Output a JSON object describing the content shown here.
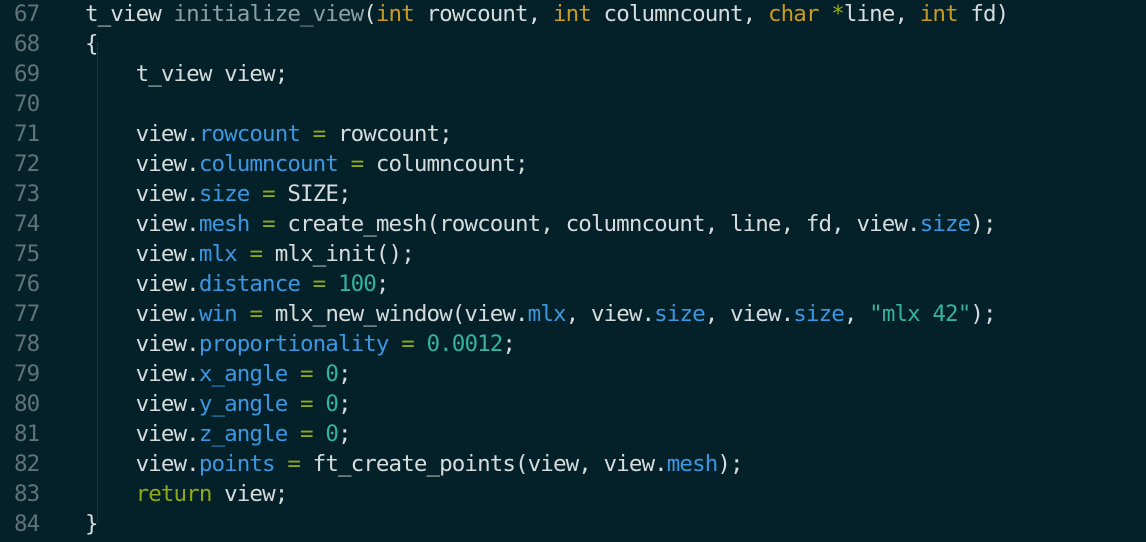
{
  "editor": {
    "colors": {
      "background": "#042029",
      "line_number": "#5f7378",
      "plain": "#d6dcdc",
      "function_name": "#8aa0a4",
      "type": "#c99b22",
      "property": "#3c97e0",
      "operator": "#8fa818",
      "number": "#33b3a0",
      "string": "#33b3a0",
      "keyword": "#8fa818"
    },
    "lines": [
      {
        "num": "67",
        "tokens": [
          {
            "t": "t_view ",
            "c": "plain"
          },
          {
            "t": "initialize_view",
            "c": "func"
          },
          {
            "t": "(",
            "c": "plain"
          },
          {
            "t": "int",
            "c": "type"
          },
          {
            "t": " rowcount, ",
            "c": "plain"
          },
          {
            "t": "int",
            "c": "type"
          },
          {
            "t": " columncount, ",
            "c": "plain"
          },
          {
            "t": "char",
            "c": "type"
          },
          {
            "t": " ",
            "c": "plain"
          },
          {
            "t": "*",
            "c": "op"
          },
          {
            "t": "line, ",
            "c": "plain"
          },
          {
            "t": "int",
            "c": "type"
          },
          {
            "t": " fd)",
            "c": "plain"
          }
        ]
      },
      {
        "num": "68",
        "tokens": [
          {
            "t": "{",
            "c": "plain"
          }
        ]
      },
      {
        "num": "69",
        "tokens": [
          {
            "t": "    t_view view;",
            "c": "plain"
          }
        ]
      },
      {
        "num": "70",
        "tokens": []
      },
      {
        "num": "71",
        "tokens": [
          {
            "t": "    view.",
            "c": "plain"
          },
          {
            "t": "rowcount",
            "c": "prop"
          },
          {
            "t": " ",
            "c": "plain"
          },
          {
            "t": "=",
            "c": "op"
          },
          {
            "t": " rowcount;",
            "c": "plain"
          }
        ]
      },
      {
        "num": "72",
        "tokens": [
          {
            "t": "    view.",
            "c": "plain"
          },
          {
            "t": "columncount",
            "c": "prop"
          },
          {
            "t": " ",
            "c": "plain"
          },
          {
            "t": "=",
            "c": "op"
          },
          {
            "t": " columncount;",
            "c": "plain"
          }
        ]
      },
      {
        "num": "73",
        "tokens": [
          {
            "t": "    view.",
            "c": "plain"
          },
          {
            "t": "size",
            "c": "prop"
          },
          {
            "t": " ",
            "c": "plain"
          },
          {
            "t": "=",
            "c": "op"
          },
          {
            "t": " SIZE;",
            "c": "plain"
          }
        ]
      },
      {
        "num": "74",
        "tokens": [
          {
            "t": "    view.",
            "c": "plain"
          },
          {
            "t": "mesh",
            "c": "prop"
          },
          {
            "t": " ",
            "c": "plain"
          },
          {
            "t": "=",
            "c": "op"
          },
          {
            "t": " create_mesh(rowcount, columncount, line, fd, view.",
            "c": "plain"
          },
          {
            "t": "size",
            "c": "prop"
          },
          {
            "t": ");",
            "c": "plain"
          }
        ]
      },
      {
        "num": "75",
        "tokens": [
          {
            "t": "    view.",
            "c": "plain"
          },
          {
            "t": "mlx",
            "c": "prop"
          },
          {
            "t": " ",
            "c": "plain"
          },
          {
            "t": "=",
            "c": "op"
          },
          {
            "t": " mlx_init();",
            "c": "plain"
          }
        ]
      },
      {
        "num": "76",
        "tokens": [
          {
            "t": "    view.",
            "c": "plain"
          },
          {
            "t": "distance",
            "c": "prop"
          },
          {
            "t": " ",
            "c": "plain"
          },
          {
            "t": "=",
            "c": "op"
          },
          {
            "t": " ",
            "c": "plain"
          },
          {
            "t": "100",
            "c": "num"
          },
          {
            "t": ";",
            "c": "plain"
          }
        ]
      },
      {
        "num": "77",
        "tokens": [
          {
            "t": "    view.",
            "c": "plain"
          },
          {
            "t": "win",
            "c": "prop"
          },
          {
            "t": " ",
            "c": "plain"
          },
          {
            "t": "=",
            "c": "op"
          },
          {
            "t": " mlx_new_window(view.",
            "c": "plain"
          },
          {
            "t": "mlx",
            "c": "prop"
          },
          {
            "t": ", view.",
            "c": "plain"
          },
          {
            "t": "size",
            "c": "prop"
          },
          {
            "t": ", view.",
            "c": "plain"
          },
          {
            "t": "size",
            "c": "prop"
          },
          {
            "t": ", ",
            "c": "plain"
          },
          {
            "t": "\"mlx 42\"",
            "c": "str"
          },
          {
            "t": ");",
            "c": "plain"
          }
        ]
      },
      {
        "num": "78",
        "tokens": [
          {
            "t": "    view.",
            "c": "plain"
          },
          {
            "t": "proportionality",
            "c": "prop"
          },
          {
            "t": " ",
            "c": "plain"
          },
          {
            "t": "=",
            "c": "op"
          },
          {
            "t": " ",
            "c": "plain"
          },
          {
            "t": "0.0012",
            "c": "num"
          },
          {
            "t": ";",
            "c": "plain"
          }
        ]
      },
      {
        "num": "79",
        "tokens": [
          {
            "t": "    view.",
            "c": "plain"
          },
          {
            "t": "x_angle",
            "c": "prop"
          },
          {
            "t": " ",
            "c": "plain"
          },
          {
            "t": "=",
            "c": "op"
          },
          {
            "t": " ",
            "c": "plain"
          },
          {
            "t": "0",
            "c": "num"
          },
          {
            "t": ";",
            "c": "plain"
          }
        ]
      },
      {
        "num": "80",
        "tokens": [
          {
            "t": "    view.",
            "c": "plain"
          },
          {
            "t": "y_angle",
            "c": "prop"
          },
          {
            "t": " ",
            "c": "plain"
          },
          {
            "t": "=",
            "c": "op"
          },
          {
            "t": " ",
            "c": "plain"
          },
          {
            "t": "0",
            "c": "num"
          },
          {
            "t": ";",
            "c": "plain"
          }
        ]
      },
      {
        "num": "81",
        "tokens": [
          {
            "t": "    view.",
            "c": "plain"
          },
          {
            "t": "z_angle",
            "c": "prop"
          },
          {
            "t": " ",
            "c": "plain"
          },
          {
            "t": "=",
            "c": "op"
          },
          {
            "t": " ",
            "c": "plain"
          },
          {
            "t": "0",
            "c": "num"
          },
          {
            "t": ";",
            "c": "plain"
          }
        ]
      },
      {
        "num": "82",
        "tokens": [
          {
            "t": "    view.",
            "c": "plain"
          },
          {
            "t": "points",
            "c": "prop"
          },
          {
            "t": " ",
            "c": "plain"
          },
          {
            "t": "=",
            "c": "op"
          },
          {
            "t": " ft_create_points(view, view.",
            "c": "plain"
          },
          {
            "t": "mesh",
            "c": "prop"
          },
          {
            "t": ");",
            "c": "plain"
          }
        ]
      },
      {
        "num": "83",
        "tokens": [
          {
            "t": "    ",
            "c": "plain"
          },
          {
            "t": "return",
            "c": "kw"
          },
          {
            "t": " view;",
            "c": "plain"
          }
        ]
      },
      {
        "num": "84",
        "tokens": [
          {
            "t": "}",
            "c": "plain"
          }
        ]
      }
    ]
  }
}
